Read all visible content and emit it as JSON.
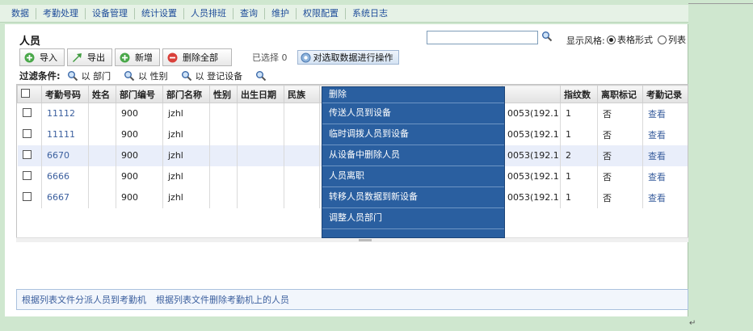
{
  "menu": [
    "数据",
    "考勤处理",
    "设备管理",
    "统计设置",
    "人员排班",
    "查询",
    "维护",
    "权限配置",
    "系统日志"
  ],
  "page": {
    "title": "人员"
  },
  "search": {
    "value": "",
    "placeholder": ""
  },
  "display_style": {
    "label": "显示风格:",
    "options": [
      {
        "label": "表格形式",
        "selected": true
      },
      {
        "label": "列表",
        "selected": false
      }
    ]
  },
  "toolbar": {
    "import_label": "导入",
    "export_label": "导出",
    "add_label": "新增",
    "delete_all_label": "删除全部",
    "selected_text": "已选择 0",
    "bulk_ops_label": "对选取数据进行操作"
  },
  "filter": {
    "label": "过滤条件:",
    "items": [
      "以 部门",
      "以 性别",
      "以 登记设备"
    ]
  },
  "table": {
    "left_headers": [
      "考勤号码",
      "姓名",
      "部门编号",
      "部门名称",
      "性别",
      "出生日期",
      "民族"
    ],
    "right_headers": [
      "指纹数",
      "离职标记",
      "考勤记录"
    ],
    "rows": [
      {
        "id": "11112",
        "name": "",
        "dept_no": "900",
        "dept_name": "jzhl",
        "gender": "",
        "birth": "",
        "nation": "",
        "device": "0053(192.1",
        "fp": "1",
        "resigned": "否",
        "record": "查看"
      },
      {
        "id": "11111",
        "name": "",
        "dept_no": "900",
        "dept_name": "jzhl",
        "gender": "",
        "birth": "",
        "nation": "",
        "device": "0053(192.1",
        "fp": "1",
        "resigned": "否",
        "record": "查看"
      },
      {
        "id": "6670",
        "name": "",
        "dept_no": "900",
        "dept_name": "jzhl",
        "gender": "",
        "birth": "",
        "nation": "",
        "device": "0053(192.1",
        "fp": "2",
        "resigned": "否",
        "record": "查看"
      },
      {
        "id": "6666",
        "name": "",
        "dept_no": "900",
        "dept_name": "jzhl",
        "gender": "",
        "birth": "",
        "nation": "",
        "device": "0053(192.1",
        "fp": "1",
        "resigned": "否",
        "record": "查看"
      },
      {
        "id": "6667",
        "name": "",
        "dept_no": "900",
        "dept_name": "jzhl",
        "gender": "",
        "birth": "",
        "nation": "",
        "device": "0053(192.1",
        "fp": "1",
        "resigned": "否",
        "record": "查看"
      }
    ]
  },
  "dropdown": {
    "items": [
      "删除",
      "传送人员到设备",
      "临时调拨人员到设备",
      "从设备中删除人员",
      "人员离职",
      "转移人员数据到新设备",
      "调整人员部门"
    ]
  },
  "footer": {
    "links": [
      "根据列表文件分派人员到考勤机",
      "根据列表文件删除考勤机上的人员"
    ]
  },
  "colors": {
    "dropdown_bg": "#2a5fa0",
    "link": "#3b5f9e",
    "row_alt": "#e9eefa",
    "page_bg": "#cfe7cf"
  },
  "icons": {
    "import": "green-plus-icon",
    "export": "green-arrow-icon",
    "add": "green-plus-icon",
    "delete_all": "red-minus-icon",
    "search": "magnifier-icon",
    "filter": "magnifier-icon",
    "bulk": "gear-icon"
  }
}
